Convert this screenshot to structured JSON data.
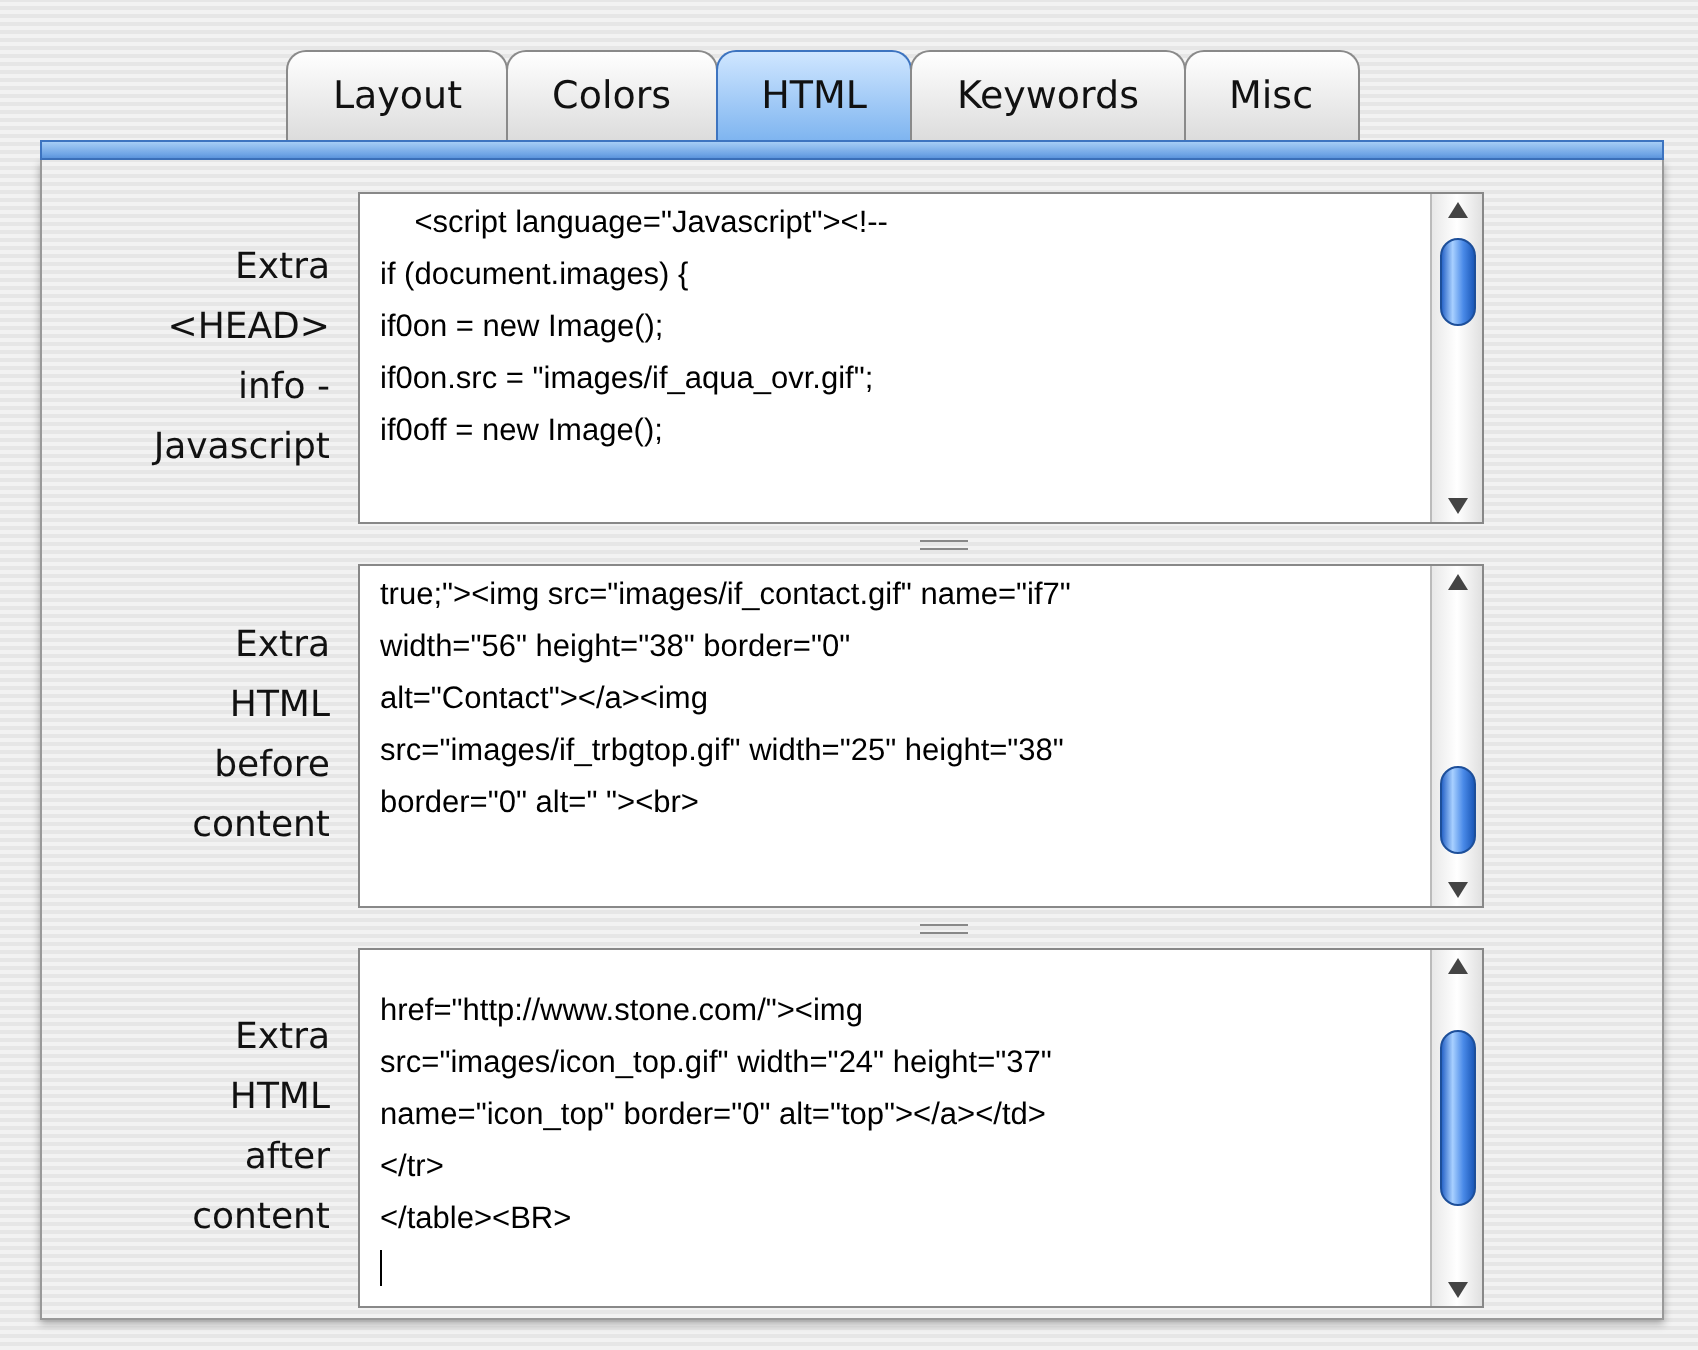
{
  "tabs": [
    {
      "label": "Layout",
      "selected": false
    },
    {
      "label": "Colors",
      "selected": false
    },
    {
      "label": "HTML",
      "selected": true
    },
    {
      "label": "Keywords",
      "selected": false
    },
    {
      "label": "Misc",
      "selected": false
    }
  ],
  "fields": [
    {
      "label": [
        "Extra",
        "<HEAD>",
        "info -",
        "Javascript"
      ],
      "lines": [
        "    <script language=\"Javascript\"><!--",
        "if (document.images) {",
        "if0on = new Image();",
        "if0on.src = \"images/if_aqua_ovr.gif\";",
        "if0off = new Image();"
      ],
      "caret": false
    },
    {
      "label": [
        "Extra",
        "HTML",
        "before",
        "content"
      ],
      "lines": [
        "true;\"><img src=\"images/if_contact.gif\" name=\"if7\"",
        "width=\"56\" height=\"38\" border=\"0\"",
        "alt=\"Contact\"></a><img",
        "src=\"images/if_trbgtop.gif\" width=\"25\" height=\"38\"",
        "border=\"0\" alt=\" \"><br>"
      ],
      "caret": false
    },
    {
      "label": [
        "Extra",
        "HTML",
        "after",
        "content"
      ],
      "lines": [
        "href=\"http://www.stone.com/\"><img",
        "src=\"images/icon_top.gif\" width=\"24\" height=\"37\"",
        "name=\"icon_top\" border=\"0\" alt=\"top\"></a></td>",
        "</tr>",
        "</table><BR>"
      ],
      "caret": true
    }
  ]
}
